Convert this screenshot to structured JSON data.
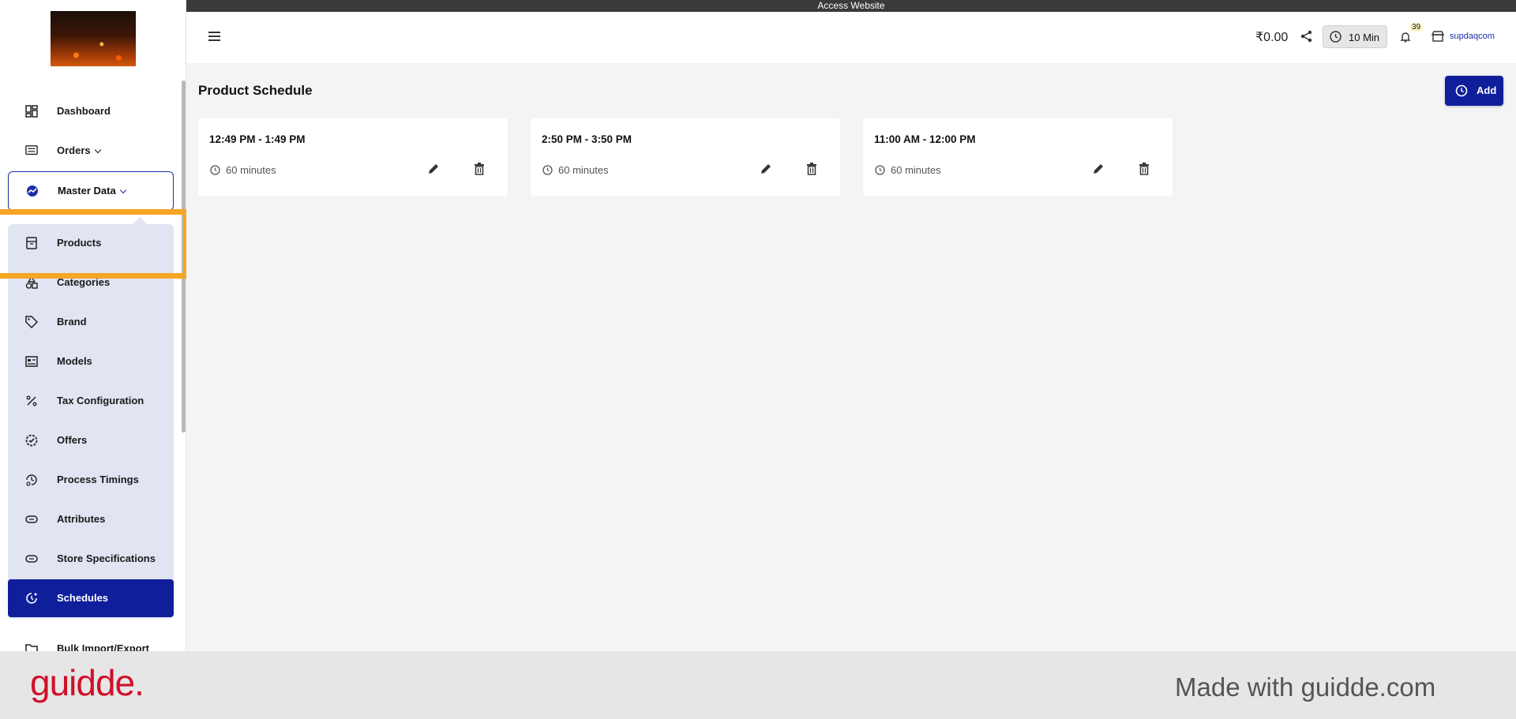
{
  "banner": {
    "text": "Access Website"
  },
  "sidebar": {
    "items": [
      {
        "label": "Dashboard",
        "icon": "dashboard-icon"
      },
      {
        "label": "Orders",
        "icon": "orders-icon",
        "has_chevron": true
      },
      {
        "label": "Master Data",
        "icon": "master-data-icon",
        "has_chevron": true,
        "expanded": true
      }
    ],
    "submenu": [
      {
        "label": "Products",
        "icon": "archive-icon"
      },
      {
        "label": "Categories",
        "icon": "categories-icon"
      },
      {
        "label": "Brand",
        "icon": "tag-icon"
      },
      {
        "label": "Models",
        "icon": "models-icon"
      },
      {
        "label": "Tax Configuration",
        "icon": "percent-icon"
      },
      {
        "label": "Offers",
        "icon": "offers-icon"
      },
      {
        "label": "Process Timings",
        "icon": "process-timings-icon"
      },
      {
        "label": "Attributes",
        "icon": "attributes-icon"
      },
      {
        "label": "Store Specifications",
        "icon": "store-spec-icon"
      },
      {
        "label": "Schedules",
        "icon": "schedules-icon",
        "active": true
      }
    ],
    "more": {
      "label": "Bulk Import/Export",
      "icon": "folder-icon"
    }
  },
  "header": {
    "price": "₹0.00",
    "time_chip": "10 Min",
    "notification_count": "39",
    "store_name": "supdaqcom"
  },
  "main": {
    "title": "Product Schedule",
    "add_label": "Add",
    "schedules": [
      {
        "time": "12:49 PM - 1:49 PM",
        "duration": "60 minutes"
      },
      {
        "time": "2:50 PM - 3:50 PM",
        "duration": "60 minutes"
      },
      {
        "time": "11:00 AM - 12:00 PM",
        "duration": "60 minutes"
      }
    ]
  },
  "footer": {
    "brand": "guidde.",
    "made_with": "Made with guidde.com"
  },
  "colors": {
    "accent": "#0f1f9b",
    "highlight": "#f5a623",
    "brand_red": "#d0102a"
  }
}
